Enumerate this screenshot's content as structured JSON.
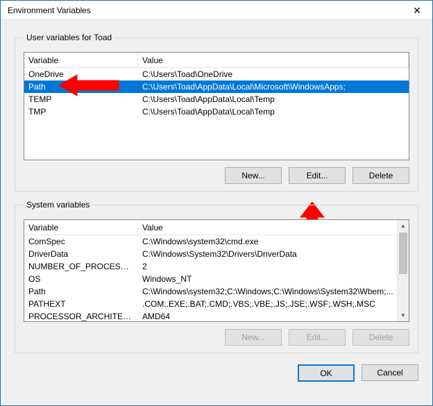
{
  "window": {
    "title": "Environment Variables"
  },
  "user_group": {
    "legend": "User variables for Toad",
    "col_var": "Variable",
    "col_val": "Value",
    "rows": [
      {
        "name": "OneDrive",
        "value": "C:\\Users\\Toad\\OneDrive",
        "selected": false
      },
      {
        "name": "Path",
        "value": "C:\\Users\\Toad\\AppData\\Local\\Microsoft\\WindowsApps;",
        "selected": true
      },
      {
        "name": "TEMP",
        "value": "C:\\Users\\Toad\\AppData\\Local\\Temp",
        "selected": false
      },
      {
        "name": "TMP",
        "value": "C:\\Users\\Toad\\AppData\\Local\\Temp",
        "selected": false
      }
    ],
    "buttons": {
      "new": "New...",
      "edit": "Edit...",
      "delete": "Delete"
    }
  },
  "sys_group": {
    "legend": "System variables",
    "col_var": "Variable",
    "col_val": "Value",
    "rows": [
      {
        "name": "ComSpec",
        "value": "C:\\Windows\\system32\\cmd.exe"
      },
      {
        "name": "DriverData",
        "value": "C:\\Windows\\System32\\Drivers\\DriverData"
      },
      {
        "name": "NUMBER_OF_PROCESSORS",
        "value": "2"
      },
      {
        "name": "OS",
        "value": "Windows_NT"
      },
      {
        "name": "Path",
        "value": "C:\\Windows\\system32;C:\\Windows;C:\\Windows\\System32\\Wbem;..."
      },
      {
        "name": "PATHEXT",
        "value": ".COM;.EXE;.BAT;.CMD;.VBS;.VBE;.JS;.JSE;.WSF;.WSH;.MSC"
      },
      {
        "name": "PROCESSOR_ARCHITECTURE",
        "value": "AMD64"
      }
    ],
    "buttons": {
      "new": "New...",
      "edit": "Edit...",
      "delete": "Delete"
    }
  },
  "dialog_buttons": {
    "ok": "OK",
    "cancel": "Cancel"
  },
  "annotation": {
    "color": "#ff0000"
  }
}
